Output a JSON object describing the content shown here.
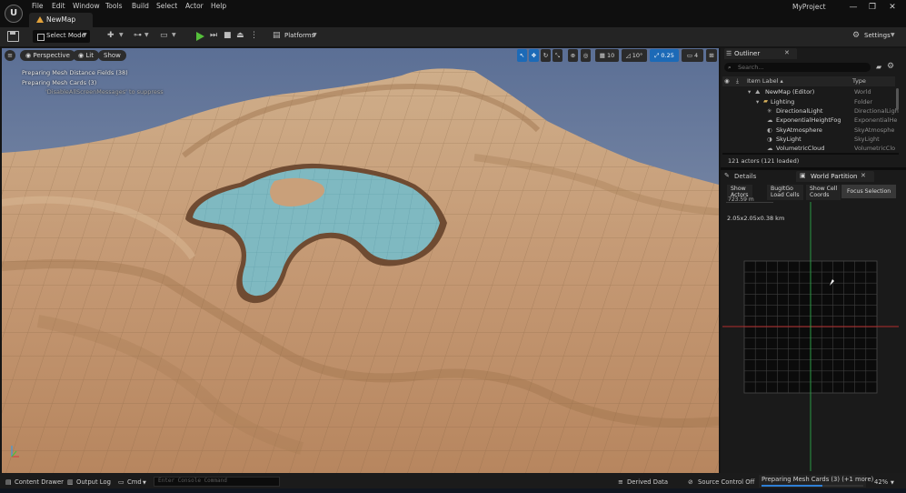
{
  "menu": {
    "logo": "U",
    "items": [
      "File",
      "Edit",
      "Window",
      "Tools",
      "Build",
      "Select",
      "Actor",
      "Help"
    ],
    "map_tab": "NewMap",
    "project": "MyProject",
    "window_buttons": [
      "—",
      "❐",
      "✕"
    ]
  },
  "toolbar": {
    "select_mode": "Select Mode",
    "platforms": "Platforms",
    "settings": "Settings"
  },
  "viewport": {
    "view_mode": "Perspective",
    "lighting": "Lit",
    "show": "Show",
    "messages": [
      "Preparing Mesh Distance Fields (38)",
      "Preparing Mesh Cards (3)",
      "'DisableAllScreenMessages' to suppress"
    ],
    "grid_snap": "10",
    "rotation_snap": "10°",
    "scale_snap": "0.25",
    "camera_speed": "4",
    "colors": {
      "sky": "#7c8fb0",
      "sand": "#c9a07a",
      "water": "#7fb9c1"
    }
  },
  "outliner": {
    "title": "Outliner",
    "search_placeholder": "Search...",
    "col_label": "Item Label ▴",
    "col_type": "Type",
    "rows": [
      {
        "label": "NewMap (Editor)",
        "type": "World"
      },
      {
        "label": "Lighting",
        "type": "Folder"
      },
      {
        "label": "DirectionalLight",
        "type": "DirectionalLigh"
      },
      {
        "label": "ExponentialHeightFog",
        "type": "ExponentialHe"
      },
      {
        "label": "SkyAtmosphere",
        "type": "SkyAtmosphe"
      },
      {
        "label": "SkyLight",
        "type": "SkyLight"
      },
      {
        "label": "VolumetricCloud",
        "type": "VolumetricClo"
      }
    ],
    "count": "121 actors (121 loaded)"
  },
  "world_partition": {
    "details_tab": "Details",
    "tab": "World Partition",
    "buttons": {
      "show_actors": [
        "Show",
        "Actors"
      ],
      "bugitgo": [
        "BugItGo",
        "Load Cells"
      ],
      "show_cell": [
        "Show Cell",
        "Coords"
      ],
      "focus": "Focus Selection"
    },
    "clipped_label": "723.59 m",
    "size": "2.05x2.05x0.38 km"
  },
  "statusbar": {
    "content_drawer": "Content Drawer",
    "output_log": "Output Log",
    "cmd": "Cmd",
    "console_placeholder": "Enter Console Command",
    "derived_data": "Derived Data",
    "source_control": "Source Control Off",
    "task": "Preparing Mesh Cards (3) (+1 more)",
    "task_progress": 0.6,
    "percent": "42%"
  }
}
